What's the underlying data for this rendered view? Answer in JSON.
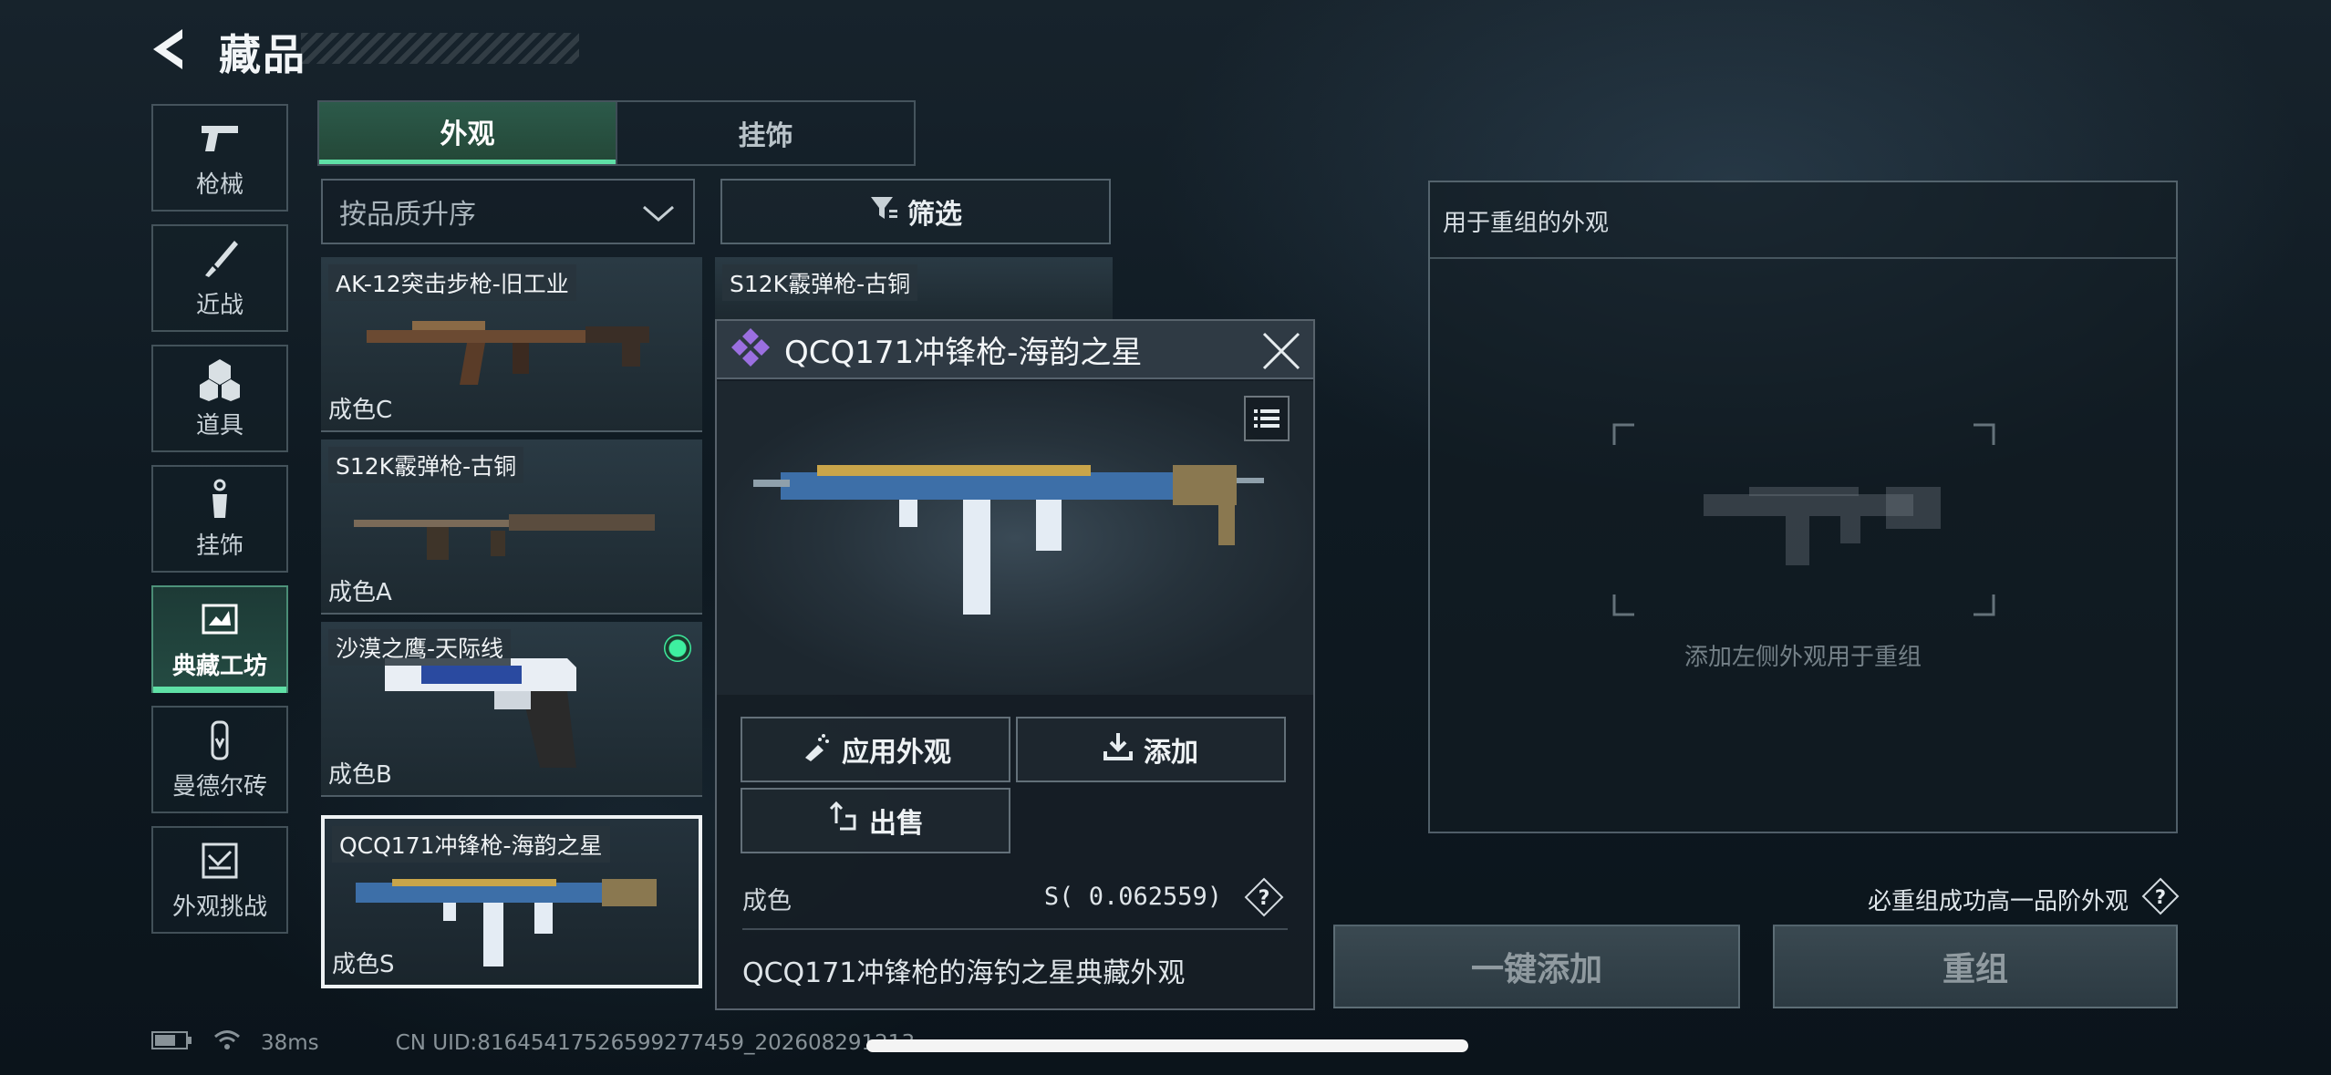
{
  "header": {
    "title": "藏品"
  },
  "categories": [
    {
      "label": "枪械",
      "icon": "gun-icon"
    },
    {
      "label": "近战",
      "icon": "knife-icon"
    },
    {
      "label": "道具",
      "icon": "grenade-icon"
    },
    {
      "label": "挂饰",
      "icon": "charm-icon"
    },
    {
      "label": "典藏工坊",
      "icon": "workshop-icon",
      "active": true
    },
    {
      "label": "曼德尔砖",
      "icon": "mandel-brick-icon"
    },
    {
      "label": "外观挑战",
      "icon": "challenge-icon"
    }
  ],
  "tabs": [
    {
      "label": "外观",
      "active": true
    },
    {
      "label": "挂饰",
      "active": false
    }
  ],
  "sort": {
    "label": "按品质升序"
  },
  "filter": {
    "label": "筛选"
  },
  "items": [
    {
      "name": "AK-12突击步枪-旧工业",
      "grade": "成色C"
    },
    {
      "name": "S12K霰弹枪-古铜",
      "grade": ""
    },
    {
      "name": "S12K霰弹枪-古铜",
      "grade": "成色A"
    },
    {
      "name": "沙漠之鹰-天际线",
      "grade": "成色B",
      "equipped": true
    },
    {
      "name": "QCQ171冲锋枪-海韵之星",
      "grade": "成色S",
      "selected": true
    }
  ],
  "popup": {
    "title": "QCQ171冲锋枪-海韵之星",
    "apply_label": "应用外观",
    "add_label": "添加",
    "sell_label": "出售",
    "grade_label": "成色",
    "grade_value": "S( 0.062559)",
    "description": "QCQ171冲锋枪的海钓之星典藏外观"
  },
  "rework": {
    "title": "用于重组的外观",
    "hint": "添加左侧外观用于重组",
    "guarantee": "必重组成功高一品阶外观",
    "oneclick_label": "一键添加",
    "rework_label": "重组"
  },
  "status": {
    "ping": "38ms",
    "uid": "CN UID:8164541752659927745­9_202608291213"
  },
  "colors": {
    "accent": "#5fe0a6",
    "rarity": "#9b6fe0"
  }
}
